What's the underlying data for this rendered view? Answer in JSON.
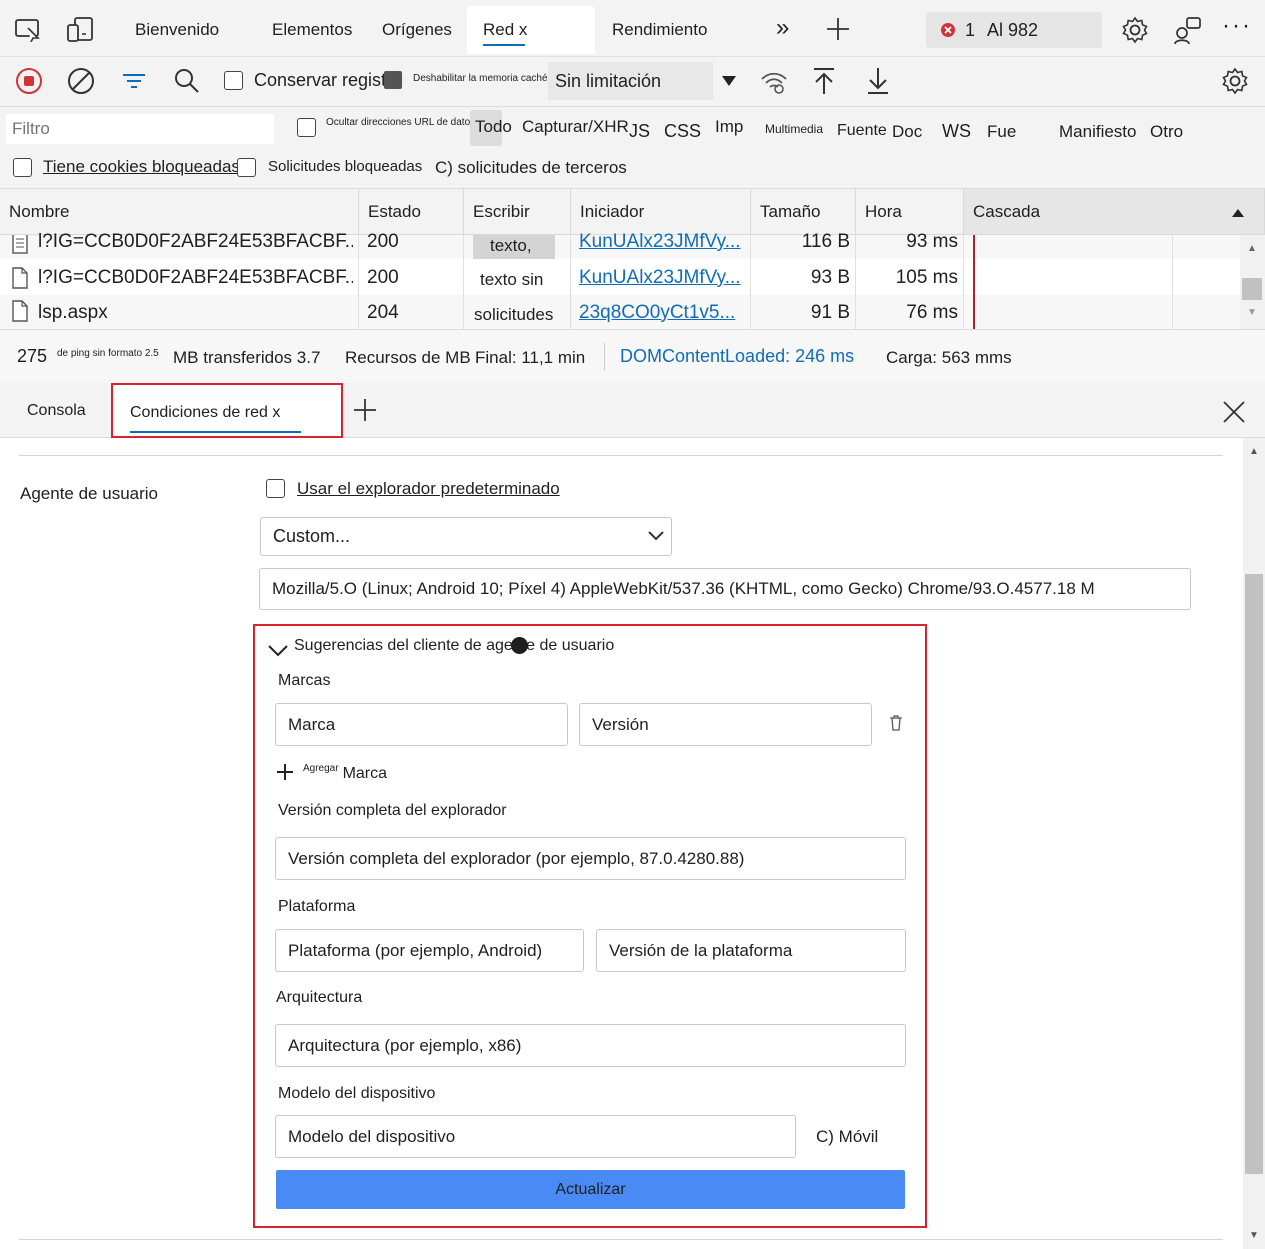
{
  "top_tabs": {
    "bienvenido": "Bienvenido",
    "elementos": "Elementos",
    "origenes": "Orígenes",
    "red": "Red x",
    "rendimiento": "Rendimiento",
    "errors_count": "1",
    "issues_label": "Al 982"
  },
  "toolbar": {
    "preserve_log": "Conservar registro",
    "disable_cache": "Deshabilitar la memoria caché",
    "throttling": "Sin limitación"
  },
  "filter": {
    "placeholder": "Filtro",
    "hide_data_urls": "Ocultar direcciones URL de datos",
    "all": "Todo",
    "fetch_xhr": "Capturar/XHR",
    "js": "JS",
    "css": "CSS",
    "img": "Imp",
    "media": "Multimedia",
    "font": "Fuente",
    "doc": "Doc",
    "ws": "WS",
    "wasm": "Fue",
    "manifest": "Manifiesto",
    "other": "Otro",
    "blocked_cookies": "Tiene cookies bloqueadas",
    "blocked_requests": "Solicitudes bloqueadas",
    "third_party": "C) solicitudes de terceros"
  },
  "table": {
    "headers": [
      "Nombre",
      "Estado",
      "Escribir",
      "Iniciador",
      "Tamaño",
      "Hora",
      "Cascada"
    ],
    "rows": [
      {
        "name": "l?IG=CCB0D0F2ABF24E53BFACBF...",
        "status": "200",
        "type": "texto,",
        "initiator": "KunUAlx23JMfVy...",
        "size": "116 B",
        "time": "93 ms"
      },
      {
        "name": "l?IG=CCB0D0F2ABF24E53BFACBF...",
        "status": "200",
        "type": "texto sin",
        "initiator": "KunUAlx23JMfVy...",
        "size": "93 B",
        "time": "105 ms"
      },
      {
        "name": "lsp.aspx",
        "status": "204",
        "type": "solicitudes",
        "initiator": "23q8CO0yCt1v5...",
        "size": "91 B",
        "time": "76 ms"
      }
    ]
  },
  "status": {
    "requests": "275",
    "ping": "de ping sin formato 2.5",
    "transferred": "MB transferidos 3.7",
    "resources": "Recursos de MB",
    "finish": "Final: 11,1 min",
    "domcontent": "DOMContentLoaded: 246 ms",
    "load": "Carga: 563 mms",
    "domcontent_color": "#0f6cbd"
  },
  "drawer": {
    "console": "Consola",
    "network_conditions": "Condiciones de red x"
  },
  "panel": {
    "user_agent_label": "Agente de usuario",
    "use_default": "Usar el explorador predeterminado",
    "ua_select": "Custom...",
    "ua_string": "Mozilla/5.O (Linux; Android 10; Píxel 4) AppleWebKit/537.36 (KHTML, como Gecko) Chrome/93.O.4577.18 M",
    "client_hints_title": "Sugerencias del cliente de agente de usuario",
    "brands_label": "Marcas",
    "brand_placeholder": "Marca",
    "version_placeholder": "Versión",
    "add_small": "Agregar",
    "add_brand": "Marca",
    "full_version_label": "Versión completa del explorador",
    "full_version_placeholder": "Versión completa del explorador (por ejemplo, 87.0.4280.88)",
    "platform_label": "Plataforma",
    "platform_placeholder": "Plataforma (por ejemplo, Android)",
    "platform_version_placeholder": "Versión de la plataforma",
    "arch_label": "Arquitectura",
    "arch_placeholder": "Arquitectura (por ejemplo, x86)",
    "model_label": "Modelo del dispositivo",
    "model_placeholder": "Modelo del dispositivo",
    "mobile": "C) Móvil",
    "update_button": "Actualizar",
    "accent": "#4a8af4",
    "highlight": "#d92230"
  }
}
